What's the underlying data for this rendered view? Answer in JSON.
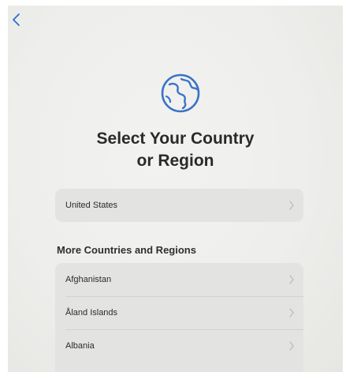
{
  "header": {
    "title_line1": "Select Your Country",
    "title_line2": "or Region"
  },
  "icons": {
    "back": "chevron-left-icon",
    "globe": "globe-icon",
    "row_chevron": "chevron-right-icon"
  },
  "colors": {
    "accent": "#3a72c8",
    "back_chevron": "#2d6fd6"
  },
  "suggested": {
    "items": [
      {
        "label": "United States"
      }
    ]
  },
  "more": {
    "header": "More Countries and Regions",
    "items": [
      {
        "label": "Afghanistan"
      },
      {
        "label": "Åland Islands"
      },
      {
        "label": "Albania"
      }
    ]
  }
}
